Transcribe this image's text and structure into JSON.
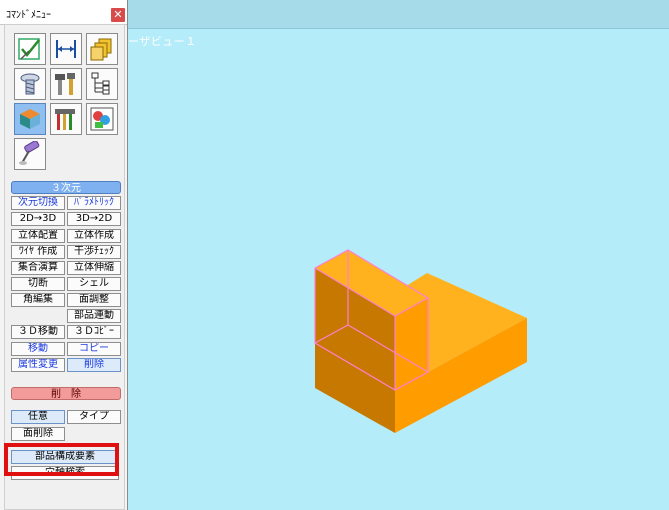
{
  "window": {
    "panel_title": "ｺﾏﾝﾄﾞﾒﾆｭｰ",
    "close_glyph": "✕",
    "view_title": "ーザビュー１"
  },
  "icons": [
    {
      "name": "verify-icon"
    },
    {
      "name": "dimension-icon"
    },
    {
      "name": "layers-icon"
    },
    {
      "name": "bolt-icon"
    },
    {
      "name": "tools-icon"
    },
    {
      "name": "tree-structure-icon"
    },
    {
      "name": "solid-cube-icon",
      "selected": true
    },
    {
      "name": "tool-set-icon"
    },
    {
      "name": "render-image-icon"
    },
    {
      "name": "paint-roller-icon"
    }
  ],
  "sections": {
    "solid_3d": "３次元",
    "delete": "削　除"
  },
  "commands": {
    "dim_convert": "次元切換",
    "parametric": "ﾊﾟﾗﾒﾄﾘｯｸ",
    "to3d": "2D→3D",
    "to2d": "3D→2D",
    "solid_place": "立体配置",
    "solid_create": "立体作成",
    "wire_create": "ﾜｲﾔ 作成",
    "interference": "干渉ﾁｪｯｸ",
    "boolean": "集合演算",
    "solid_stretch": "立体伸縮",
    "cut": "切断",
    "shell": "シェル",
    "corner_edit": "角編集",
    "face_adjust": "面調整",
    "part_link": "部品連動",
    "move3d": "３Ｄ移動",
    "copy3d": "３Ｄｺﾋﾟｰ",
    "move": "移動",
    "copy": "コピー",
    "attr_change": "属性変更",
    "remove": "削除",
    "arbitrary": "任意",
    "type": "タイプ",
    "face_delete": "面削除",
    "part_element": "部品構成要素",
    "shaft_search": "穴軸検索"
  },
  "colors": {
    "viewport_bg": "#b4ecfa",
    "solid_top": "#ffb21e",
    "solid_left": "#c77800",
    "solid_right": "#ff9d00",
    "selection_edge": "#ff7fd0",
    "highlight_frame": "#e01010"
  }
}
